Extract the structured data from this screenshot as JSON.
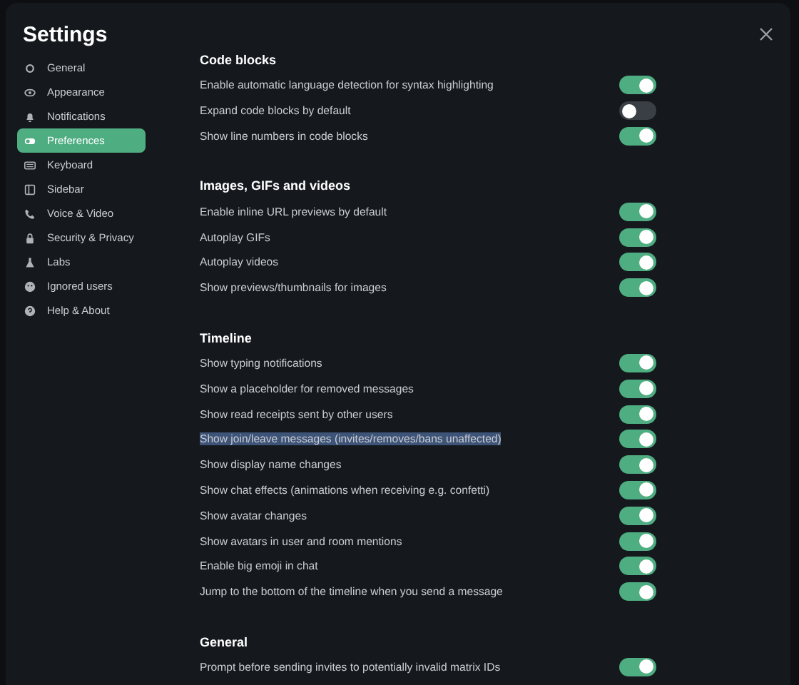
{
  "window": {
    "title": "Settings"
  },
  "sidebar": {
    "items": [
      {
        "label": "General",
        "selected": false
      },
      {
        "label": "Appearance",
        "selected": false
      },
      {
        "label": "Notifications",
        "selected": false
      },
      {
        "label": "Preferences",
        "selected": true
      },
      {
        "label": "Keyboard",
        "selected": false
      },
      {
        "label": "Sidebar",
        "selected": false
      },
      {
        "label": "Voice & Video",
        "selected": false
      },
      {
        "label": "Security & Privacy",
        "selected": false
      },
      {
        "label": "Labs",
        "selected": false
      },
      {
        "label": "Ignored users",
        "selected": false
      },
      {
        "label": "Help & About",
        "selected": false
      }
    ]
  },
  "sections": [
    {
      "heading": "Code blocks",
      "settings": [
        {
          "label": "Enable automatic language detection for syntax highlighting",
          "on": true,
          "text_selected": false
        },
        {
          "label": "Expand code blocks by default",
          "on": false,
          "text_selected": false
        },
        {
          "label": "Show line numbers in code blocks",
          "on": true,
          "text_selected": false
        }
      ]
    },
    {
      "heading": "Images, GIFs and videos",
      "settings": [
        {
          "label": "Enable inline URL previews by default",
          "on": true,
          "text_selected": false
        },
        {
          "label": "Autoplay GIFs",
          "on": true,
          "text_selected": false
        },
        {
          "label": "Autoplay videos",
          "on": true,
          "text_selected": false
        },
        {
          "label": "Show previews/thumbnails for images",
          "on": true,
          "text_selected": false
        }
      ]
    },
    {
      "heading": "Timeline",
      "settings": [
        {
          "label": "Show typing notifications",
          "on": true,
          "text_selected": false
        },
        {
          "label": "Show a placeholder for removed messages",
          "on": true,
          "text_selected": false
        },
        {
          "label": "Show read receipts sent by other users",
          "on": true,
          "text_selected": false
        },
        {
          "label": "Show join/leave messages (invites/removes/bans unaffected)",
          "on": true,
          "text_selected": true
        },
        {
          "label": "Show display name changes",
          "on": true,
          "text_selected": false
        },
        {
          "label": "Show chat effects (animations when receiving e.g. confetti)",
          "on": true,
          "text_selected": false
        },
        {
          "label": "Show avatar changes",
          "on": true,
          "text_selected": false
        },
        {
          "label": "Show avatars in user and room mentions",
          "on": true,
          "text_selected": false
        },
        {
          "label": "Enable big emoji in chat",
          "on": true,
          "text_selected": false
        },
        {
          "label": "Jump to the bottom of the timeline when you send a message",
          "on": true,
          "text_selected": false
        }
      ]
    },
    {
      "heading": "General",
      "settings": [
        {
          "label": "Prompt before sending invites to potentially invalid matrix IDs",
          "on": true,
          "text_selected": false
        }
      ]
    }
  ]
}
